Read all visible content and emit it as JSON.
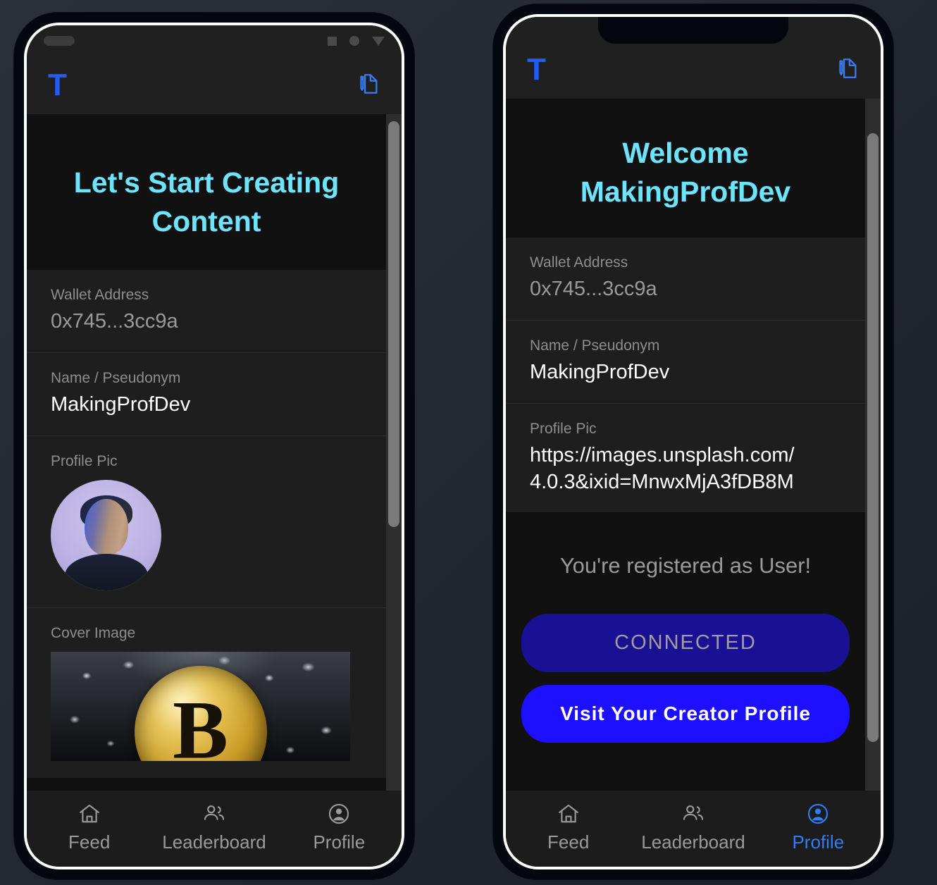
{
  "app": {
    "brand_letter": "T",
    "header_icon": "document-edit-icon"
  },
  "left_phone": {
    "platform": "android",
    "status_bar": {
      "pill": "notification-pill",
      "nav_icons": [
        "square-icon",
        "circle-icon",
        "triangle-icon"
      ]
    },
    "headline": "Let's Start Creating Content",
    "fields": [
      {
        "label": "Wallet Address",
        "value": "0x745...3cc9a",
        "dim": true
      },
      {
        "label": "Name / Pseudonym",
        "value": "MakingProfDev",
        "dim": false
      },
      {
        "label": "Profile Pic",
        "value": "",
        "media": "avatar-portrait"
      },
      {
        "label": "Cover Image",
        "value": "",
        "media": "bitcoin-cover"
      }
    ],
    "tabs": [
      {
        "label": "Feed",
        "icon": "home-icon",
        "active": false
      },
      {
        "label": "Leaderboard",
        "icon": "people-icon",
        "active": false
      },
      {
        "label": "Profile",
        "icon": "account-circle-icon",
        "active": false
      }
    ],
    "scroll": {
      "thumb_top_pct": 1,
      "thumb_height_pct": 60
    }
  },
  "right_phone": {
    "platform": "ios",
    "headline": "Welcome MakingProfDev",
    "fields": [
      {
        "label": "Wallet Address",
        "value": "0x745...3cc9a",
        "dim": true
      },
      {
        "label": "Name / Pseudonym",
        "value": "MakingProfDev",
        "dim": false
      }
    ],
    "profile_pic": {
      "label": "Profile Pic",
      "line1": "https://images.unsplash.com/",
      "line2": "4.0.3&ixid=MnwxMjA3fDB8M"
    },
    "registered_text": "You're registered as User!",
    "buttons": {
      "connected": "CONNECTED",
      "visit_profile": "Visit Your Creator Profile"
    },
    "tabs": [
      {
        "label": "Feed",
        "icon": "home-icon",
        "active": false
      },
      {
        "label": "Leaderboard",
        "icon": "people-icon",
        "active": false
      },
      {
        "label": "Profile",
        "icon": "account-circle-icon",
        "active": true
      }
    ],
    "scroll": {
      "thumb_top_pct": 5,
      "thumb_height_pct": 88
    }
  },
  "colors": {
    "accent_cyan": "#6de4fb",
    "brand_blue": "#1f5cff",
    "button_primary": "#1d0fff",
    "button_disabled": "#1a1094",
    "tab_active": "#2f7dfb",
    "card_bg": "#1e1e1e",
    "screen_bg": "#111111"
  }
}
